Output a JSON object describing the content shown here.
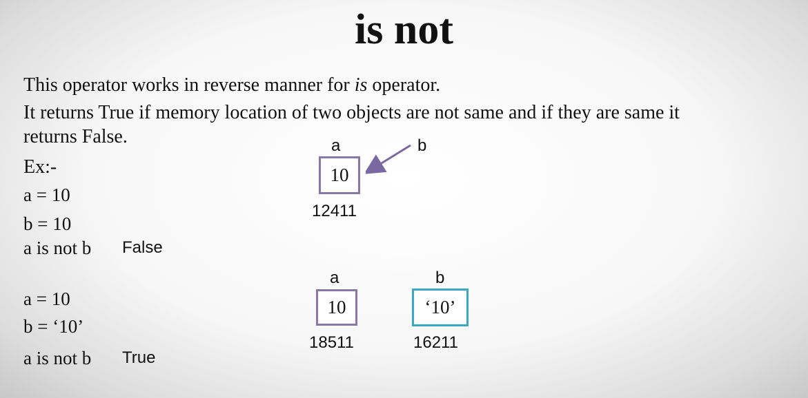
{
  "title": "is not",
  "description": {
    "line1_pre": "This operator works in reverse manner for ",
    "line1_em": "is",
    "line1_post": " operator.",
    "line2": "It returns True if memory location of two objects are not same and if they are same it",
    "line3": "returns False."
  },
  "example": {
    "label": "Ex:-",
    "case1": {
      "a": "a = 10",
      "b": "b = 10",
      "expr": "a is not b",
      "result": "False"
    },
    "case2": {
      "a": "a = 10",
      "b": "b = ‘10’",
      "expr": "a is not b",
      "result": "True"
    }
  },
  "diagram1": {
    "var_a": "a",
    "var_b": "b",
    "value": "10",
    "address": "12411"
  },
  "diagram2": {
    "left": {
      "var": "a",
      "value": "10",
      "address": "18511"
    },
    "right": {
      "var": "b",
      "value": "‘10’",
      "address": "16211"
    }
  },
  "colors": {
    "box_purple": "#8a76a8",
    "box_teal": "#3aa8c4",
    "arrow": "#7a68a0"
  }
}
